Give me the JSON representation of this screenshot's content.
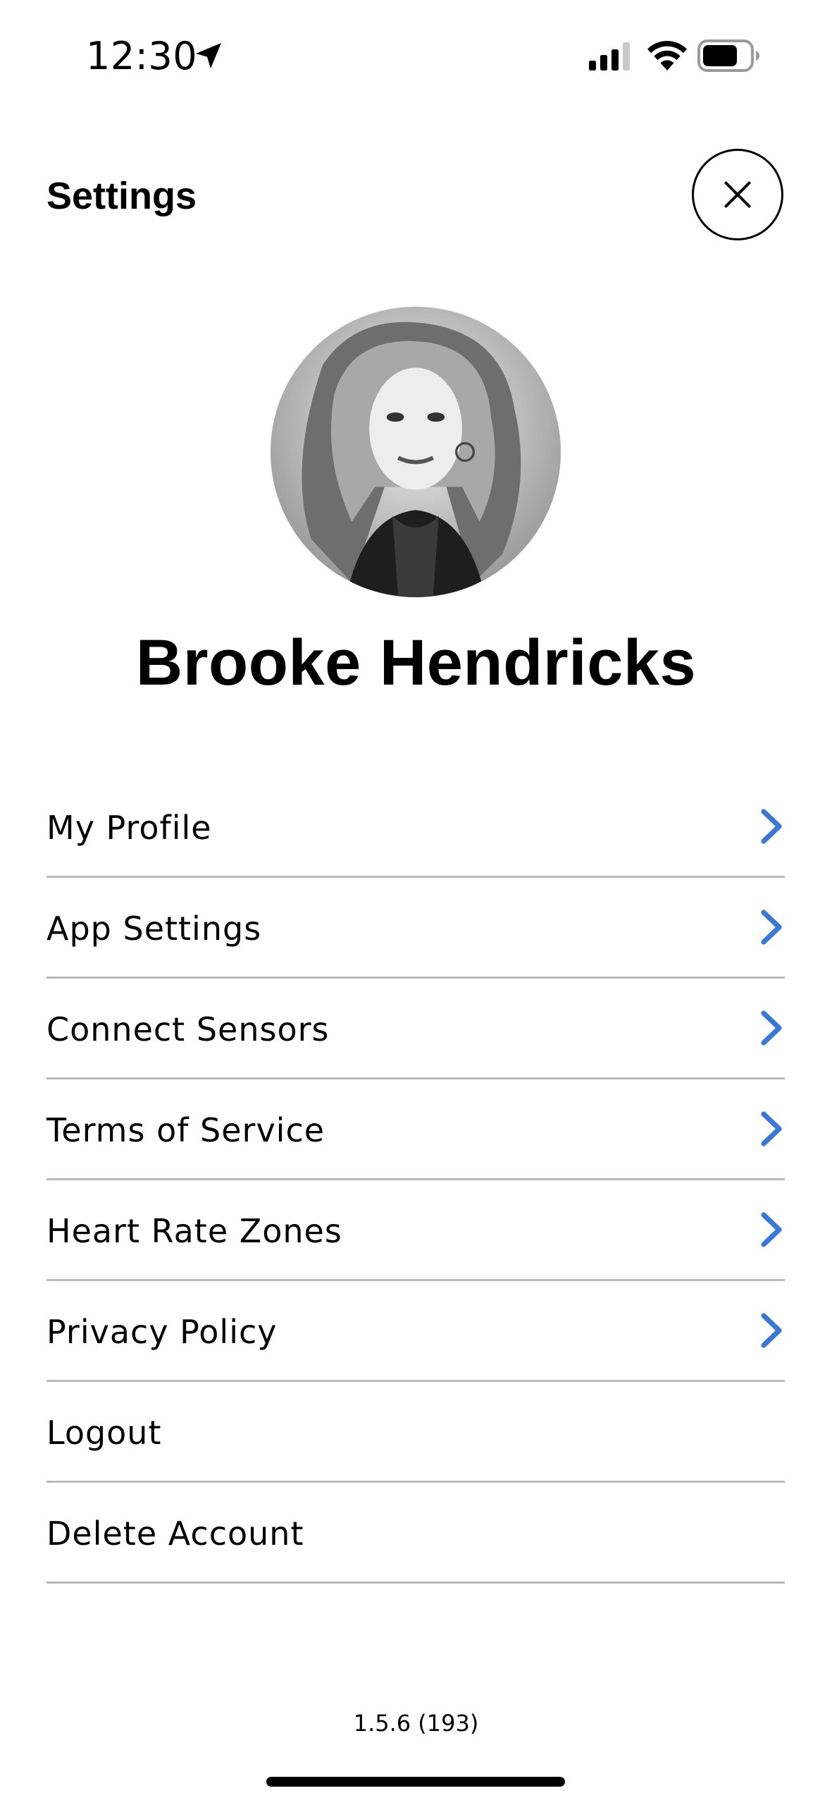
{
  "status_bar": {
    "time": "12:30",
    "icons": [
      "location-arrow-icon",
      "cellular-signal-icon",
      "wifi-icon",
      "battery-icon"
    ]
  },
  "header": {
    "title": "Settings",
    "close_icon": "close-icon"
  },
  "profile": {
    "avatar": "profile-photo",
    "name": "Brooke Hendricks"
  },
  "menu": {
    "items": [
      {
        "label": "My Profile",
        "has_chevron": true
      },
      {
        "label": "App Settings",
        "has_chevron": true
      },
      {
        "label": "Connect Sensors",
        "has_chevron": true
      },
      {
        "label": "Terms of Service",
        "has_chevron": true
      },
      {
        "label": "Heart Rate Zones",
        "has_chevron": true
      },
      {
        "label": "Privacy Policy",
        "has_chevron": true
      },
      {
        "label": "Logout",
        "has_chevron": false
      },
      {
        "label": "Delete Account",
        "has_chevron": false
      }
    ]
  },
  "footer": {
    "version": "1.5.6 (193)"
  },
  "colors": {
    "accent": "#3a78d8",
    "divider": "#b9b9b9",
    "text": "#000000",
    "background": "#ffffff"
  }
}
